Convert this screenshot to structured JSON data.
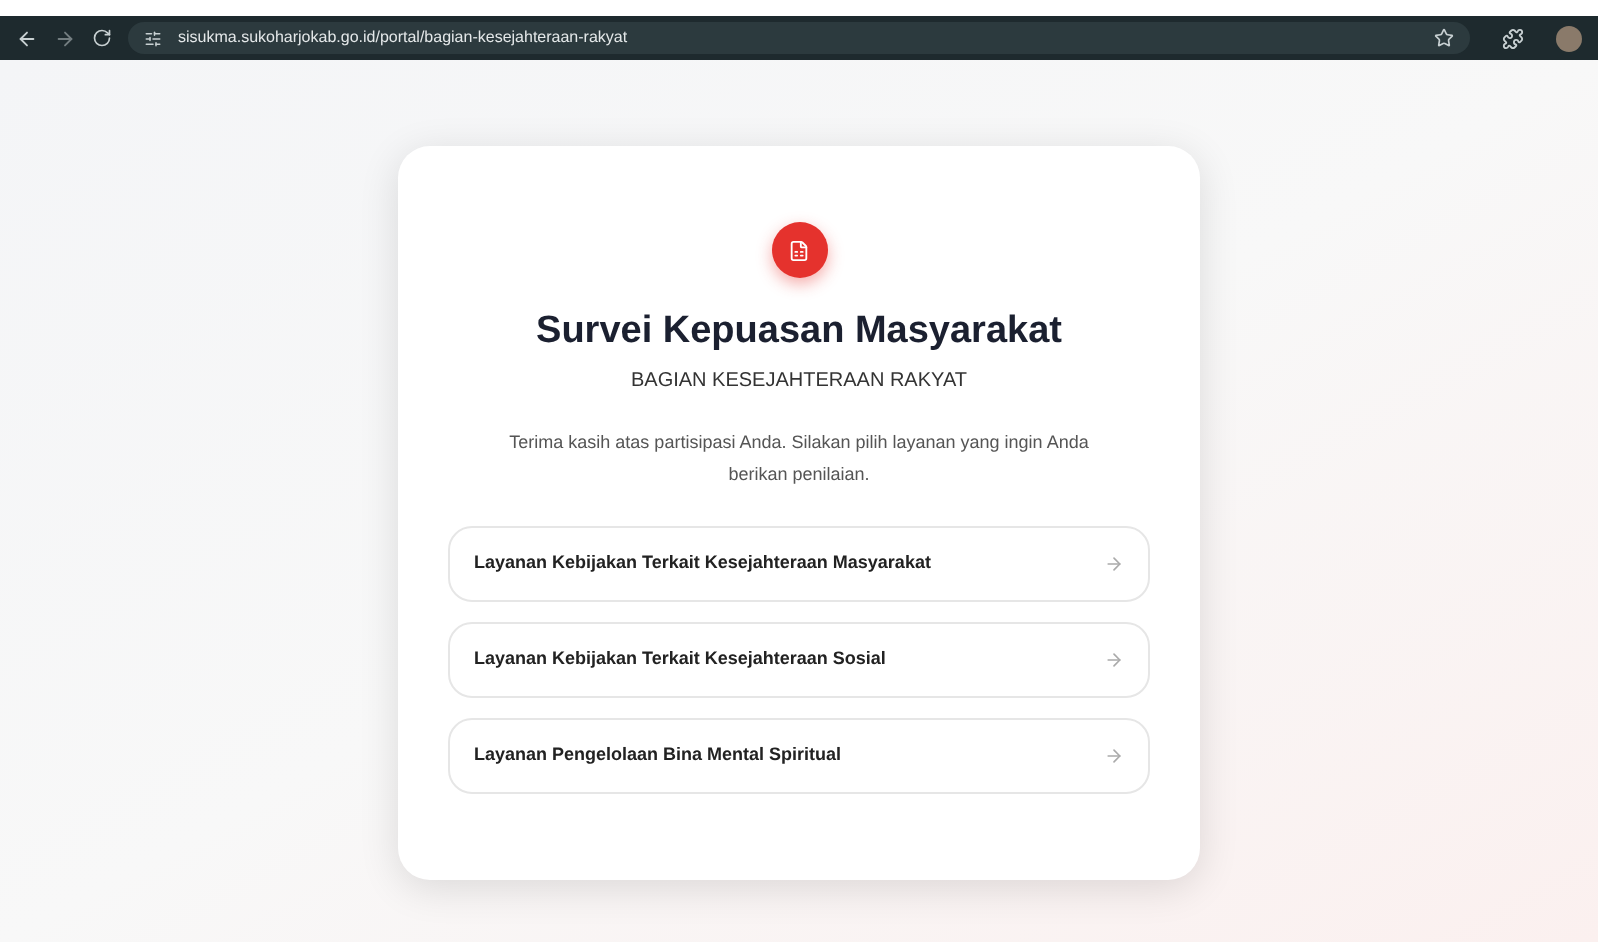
{
  "browser": {
    "url": "sisukma.sukoharjokab.go.id/portal/bagian-kesejahteraan-rakyat"
  },
  "card": {
    "title": "Survei Kepuasan Masyarakat",
    "subtitle": "BAGIAN KESEJAHTERAAN RAKYAT",
    "description": "Terima kasih atas partisipasi Anda. Silakan pilih layanan yang ingin Anda berikan penilaian.",
    "services": [
      {
        "label": "Layanan Kebijakan Terkait Kesejahteraan Masyarakat"
      },
      {
        "label": "Layanan Kebijakan Terkait Kesejahteraan Sosial"
      },
      {
        "label": "Layanan Pengelolaan Bina Mental Spiritual"
      }
    ]
  }
}
